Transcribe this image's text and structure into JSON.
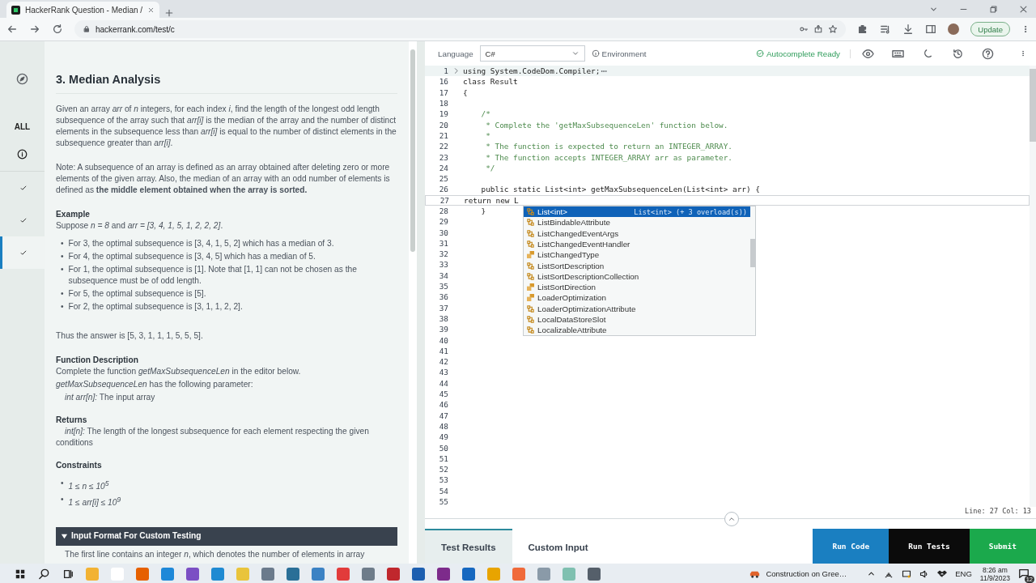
{
  "browser": {
    "tab_title": "HackerRank Question - Median /",
    "url": "hackerrank.com/test/c",
    "update_label": "Update"
  },
  "rail": {
    "all_label": "ALL",
    "questions": [
      {
        "done": true,
        "selected": false
      },
      {
        "done": true,
        "selected": false
      },
      {
        "done": true,
        "selected": true
      }
    ]
  },
  "problem": [
    {
      "kind": "title",
      "text": "3. Median Analysis"
    },
    {
      "kind": "para",
      "text": "Given an array *arr* of *n* integers, for each index *i*, find the length of the longest odd length subsequence of the array such that *arr[i]* is the median of the array and the number of distinct elements in the subsequence less than *arr[i]* is equal to the number of distinct elements in the subsequence greater than *arr[i]*."
    },
    {
      "kind": "para",
      "text": "Note: A subsequence of an array is defined as an array obtained after deleting zero or more elements of the given array. Also, the median of an array with an odd number of elements is defined as **the middle element obtained when the array is sorted.**"
    },
    {
      "kind": "heading",
      "text": "Example"
    },
    {
      "kind": "line",
      "text": "Suppose *n = 8* and *arr = [3, 4, 1, 5, 1, 2, 2, 2]*."
    },
    {
      "kind": "bullets",
      "italic": false,
      "marker": "•",
      "items": [
        "For 3, the optimal subsequence is [3, 4, 1, 5, 2] which has a median of 3.",
        "For 4, the optimal subsequence is [3, 4, 5] which has a median of 5.",
        "For 1, the optimal subsequence is [1]. Note that [1, 1] can not be chosen as the subsequence must be of odd length.",
        "For 5, the optimal subsequence is [5].",
        "For 2, the optimal subsequence is [3, 1, 1, 2, 2]."
      ]
    },
    {
      "kind": "para",
      "text": "Thus the answer is [5, 3, 1, 1, 1, 5, 5, 5]."
    },
    {
      "kind": "heading",
      "text": "Function Description"
    },
    {
      "kind": "line",
      "text": "Complete the function *getMaxSubsequenceLen* in the editor below."
    },
    {
      "kind": "line",
      "text": "*getMaxSubsequenceLen* has the following parameter:"
    },
    {
      "kind": "indent",
      "text": "*int arr[n]:* The input array"
    },
    {
      "kind": "heading",
      "text": "Returns"
    },
    {
      "kind": "indent",
      "text": "*int[n]:* The length of the longest subsequence for each element respecting the given conditions"
    },
    {
      "kind": "heading",
      "text": "Constraints"
    },
    {
      "kind": "bullets",
      "italic": true,
      "marker": "•",
      "items": [
        "1 ≤ n ≤ 10$^{5}$",
        "1 ≤ arr[i] ≤ 10$^{9}$"
      ]
    },
    {
      "kind": "bar",
      "expanded": true,
      "text": "Input Format For Custom Testing"
    },
    {
      "kind": "indent",
      "text": "The first line contains an integer *n*, which denotes the number of elements in array"
    }
  ],
  "editor": {
    "language_label": "Language",
    "language": "C#",
    "environment": "Environment",
    "autocomplete_status": "Autocomplete Ready",
    "lines": [
      {
        "n": "1",
        "kind": "code",
        "text": "using System.CodeDom.Compiler;",
        "folded": true,
        "current": false
      },
      {
        "n": "16",
        "kind": "code",
        "text": "class Result",
        "folded": false,
        "current": false
      },
      {
        "n": "17",
        "kind": "code",
        "text": "{",
        "folded": false,
        "current": false
      },
      {
        "n": "18",
        "folded": false,
        "current": false
      },
      {
        "n": "19",
        "kind": "comment",
        "text": "    /*",
        "folded": false,
        "current": false
      },
      {
        "n": "20",
        "kind": "comment",
        "text": "     * Complete the 'getMaxSubsequenceLen' function below.",
        "folded": false,
        "current": false
      },
      {
        "n": "21",
        "kind": "comment",
        "text": "     *",
        "folded": false,
        "current": false
      },
      {
        "n": "22",
        "kind": "comment",
        "text": "     * The function is expected to return an INTEGER_ARRAY.",
        "folded": false,
        "current": false
      },
      {
        "n": "23",
        "kind": "comment",
        "text": "     * The function accepts INTEGER_ARRAY arr as parameter.",
        "folded": false,
        "current": false
      },
      {
        "n": "24",
        "kind": "comment",
        "text": "     */",
        "folded": false,
        "current": false
      },
      {
        "n": "25",
        "folded": false,
        "current": false
      },
      {
        "n": "26",
        "kind": "code",
        "text": "    public static List<int> getMaxSubsequenceLen(List<int> arr) {",
        "folded": false,
        "current": false
      },
      {
        "n": "27",
        "kind": "code",
        "text": "return new L",
        "folded": false,
        "current": true
      },
      {
        "n": "28",
        "kind": "code",
        "text": "    }",
        "folded": false,
        "current": false
      },
      {
        "n": "29",
        "folded": false,
        "current": false
      },
      {
        "n": "30",
        "folded": false,
        "current": false
      },
      {
        "n": "31",
        "folded": false,
        "current": false
      },
      {
        "n": "32",
        "folded": false,
        "current": false
      },
      {
        "n": "33",
        "folded": false,
        "current": false
      },
      {
        "n": "34",
        "folded": false,
        "current": false
      },
      {
        "n": "35",
        "folded": false,
        "current": false
      },
      {
        "n": "36",
        "folded": false,
        "current": false
      },
      {
        "n": "37",
        "folded": false,
        "current": false
      },
      {
        "n": "38",
        "folded": false,
        "current": false
      },
      {
        "n": "39",
        "folded": false,
        "current": false
      },
      {
        "n": "40",
        "folded": false,
        "current": false
      },
      {
        "n": "41",
        "folded": false,
        "current": false
      },
      {
        "n": "42",
        "folded": false,
        "current": false
      },
      {
        "n": "43",
        "folded": false,
        "current": false
      },
      {
        "n": "44",
        "folded": false,
        "current": false
      },
      {
        "n": "45",
        "folded": false,
        "current": false
      },
      {
        "n": "46",
        "folded": false,
        "current": false
      },
      {
        "n": "47",
        "folded": false,
        "current": false
      },
      {
        "n": "48",
        "folded": false,
        "current": false
      },
      {
        "n": "49",
        "folded": false,
        "current": false
      },
      {
        "n": "50",
        "folded": false,
        "current": false
      },
      {
        "n": "51",
        "folded": false,
        "current": false
      },
      {
        "n": "52",
        "folded": false,
        "current": false
      },
      {
        "n": "53",
        "folded": false,
        "current": false
      },
      {
        "n": "54",
        "folded": false,
        "current": false
      },
      {
        "n": "55",
        "folded": false,
        "current": false
      }
    ],
    "suggestions": [
      {
        "label": "List<int>",
        "kind": "class",
        "selected": true,
        "detail": "List<int> (+ 3 overload(s))"
      },
      {
        "label": "ListBindableAttribute",
        "kind": "class",
        "selected": false
      },
      {
        "label": "ListChangedEventArgs",
        "kind": "class",
        "selected": false
      },
      {
        "label": "ListChangedEventHandler",
        "kind": "class",
        "selected": false
      },
      {
        "label": "ListChangedType",
        "kind": "enum",
        "selected": false
      },
      {
        "label": "ListSortDescription",
        "kind": "class",
        "selected": false
      },
      {
        "label": "ListSortDescriptionCollection",
        "kind": "class",
        "selected": false
      },
      {
        "label": "ListSortDirection",
        "kind": "enum",
        "selected": false
      },
      {
        "label": "LoaderOptimization",
        "kind": "enum",
        "selected": false
      },
      {
        "label": "LoaderOptimizationAttribute",
        "kind": "class",
        "selected": false
      },
      {
        "label": "LocalDataStoreSlot",
        "kind": "class",
        "selected": false
      },
      {
        "label": "LocalizableAttribute",
        "kind": "class",
        "selected": false
      }
    ],
    "cursor_position": "Line: 27 Col: 13",
    "tabs": [
      {
        "label": "Test Results",
        "selected": true
      },
      {
        "label": "Custom Input",
        "selected": false
      }
    ],
    "actions": [
      {
        "label": "Run Code",
        "kind": "run"
      },
      {
        "label": "Run Tests",
        "kind": "tests"
      },
      {
        "label": "Submit",
        "kind": "submit"
      }
    ]
  },
  "taskbar": {
    "notification": "Construction on Gree…",
    "language": "ENG",
    "time": "8:26 am",
    "date": "11/9/2023",
    "badge": "12"
  }
}
